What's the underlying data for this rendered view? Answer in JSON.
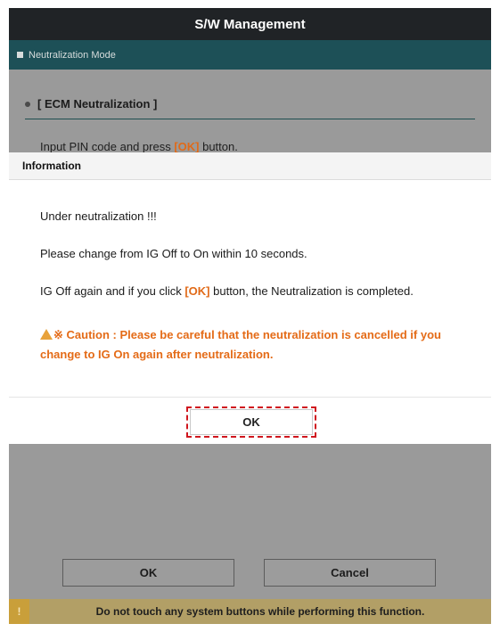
{
  "window": {
    "title": "S/W Management"
  },
  "mode_bar": {
    "label": "Neutralization Mode"
  },
  "section": {
    "title": "[ ECM Neutralization ]"
  },
  "pin_prompt": {
    "before": "Input PIN code and press ",
    "ok": "[OK]",
    "after": " button."
  },
  "dialog": {
    "title": "Information",
    "line1": "Under neutralization !!!",
    "line2": "Please change from IG Off to On within 10 seconds.",
    "line3_before": "IG Off again and if you click ",
    "line3_ok": "[OK]",
    "line3_after": " button, the Neutralization is completed.",
    "caution_symbol": "※",
    "caution_line1": " Caution : Please be careful that the neutralization is cancelled if you",
    "caution_line2": "change to IG On again after neutralization.",
    "ok_label": "OK"
  },
  "bottom_buttons": {
    "ok": "OK",
    "cancel": "Cancel"
  },
  "warning_bar": {
    "icon_char": "!",
    "message": "Do not touch any system buttons while performing this function."
  },
  "colors": {
    "accent_orange": "#e46b17",
    "header_dark": "#202326",
    "mode_bar_teal": "#1d5057",
    "highlight_red": "#d0161e"
  }
}
